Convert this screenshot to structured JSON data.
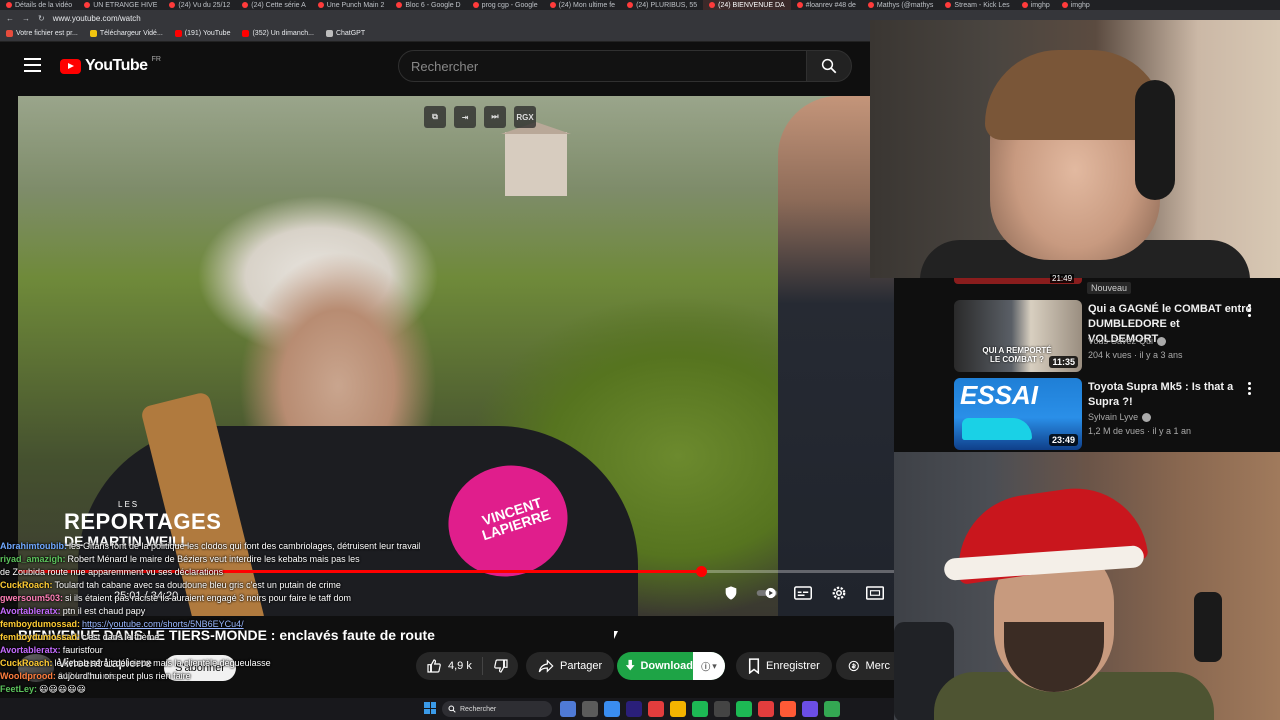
{
  "browser": {
    "tabs": [
      "Détails de la vidéo",
      "UN ETRANGE HIVE",
      "(24) Vu du 25/12",
      "(24) Cette série A",
      "Une Punch Main 2",
      "Bloc 6 - Google D",
      "prog cgp - Google",
      "(24) Mon ultime fe",
      "(24) PLURIBUS, 55",
      "(24) BIENVENUE DA",
      "#loanrev #48 de",
      "Mathys (@mathys",
      "Stream - Kick Les",
      "imghp",
      "imghp"
    ],
    "active_tab_index": 9,
    "url": "www.youtube.com/watch",
    "bookmarks": [
      {
        "label": "Votre fichier est pr...",
        "color": "#e74c3c"
      },
      {
        "label": "Téléchargeur Vidé...",
        "color": "#f1c40f"
      },
      {
        "label": "(191) YouTube",
        "color": "#ff0000"
      },
      {
        "label": "(352) Un dimanch...",
        "color": "#ff0000"
      },
      {
        "label": "ChatGPT",
        "color": "#bdbdbd"
      }
    ]
  },
  "header": {
    "logo_text": "YouTube",
    "logo_region": "FR",
    "search_placeholder": "Rechercher"
  },
  "player": {
    "top_controls": [
      "⧉",
      "⇥",
      "⏭",
      "RGX"
    ],
    "overlay": {
      "les": "LES",
      "reportages": "REPORTAGES",
      "sub": "DE MARTIN WEILL"
    },
    "time": "25:01 / 34:20",
    "progress": 0.78,
    "mic_text": "VINCENT LAPIERRE"
  },
  "video": {
    "title": "BIENVENUE DANS LE TIERS-MONDE : enclavés faute de route",
    "channel": "Vincent Lapierre",
    "subscribers": "642 k abonnés",
    "subscribe_label": "S'abonner",
    "likes": "4,9 k",
    "share_label": "Partager",
    "download_label": "Download",
    "save_label": "Enregistrer",
    "merci_label": "Merc"
  },
  "chat": [
    {
      "user": "Abrahimtoubib:",
      "color": "#6fa8ff",
      "msg": "les Gitans font de la politique les clodos qui font des cambriolages, détruisent leur travail"
    },
    {
      "user": "riyad_amazigh:",
      "color": "#5cc35c",
      "msg": "Robert Ménard le maire de Béziers veut interdire les kebabs mais pas les"
    },
    {
      "user": "",
      "color": "#fff",
      "msg": "de Zoubida route nue apparemment vu ses déclarations"
    },
    {
      "user": "CuckRoach:",
      "color": "#ffcc33",
      "msg": "Toulard tah cabane avec sa doudoune bleu gris c'est un putain de crime"
    },
    {
      "user": "gwersoum503:",
      "color": "#ff7eb6",
      "msg": "si ils étaient pas raciste ils auraient engagé 3 noirs pour faire le taff dom"
    },
    {
      "user": "Avortableratx:",
      "color": "#c46bff",
      "msg": "ptn il est chaud papy"
    },
    {
      "user": "femboydumossad:",
      "color": "#ffcc33",
      "msg": "https://youtube.com/shorts/5NB6EYCu4/",
      "link": true
    },
    {
      "user": "femboydumossad:",
      "color": "#ffcc33",
      "msg": "c'est dans le thème"
    },
    {
      "user": "Avortableratx:",
      "color": "#c46bff",
      "msg": "fauristfour"
    },
    {
      "user": "CuckRoach:",
      "color": "#ffcc33",
      "msg": "le kebab serait délicieux mais la clientèle dégueulasse"
    },
    {
      "user": "Wooldprood:",
      "color": "#ff7e3e",
      "msg": "aujourd'hui on peut plus rien faire"
    },
    {
      "user": "FeetLey:",
      "color": "#5cc35c",
      "msg": "😃😃😃😃😃"
    }
  ],
  "sidebar": {
    "nouveau": "Nouveau",
    "prev_duration": "21:49",
    "recs": [
      {
        "title": "Qui a GAGNÉ le COMBAT entre DUMBLEDORE et VOLDEMORT...",
        "channel": "Vous-Savez-Qui",
        "meta": "204 k vues · il y a 3 ans",
        "duration": "11:35",
        "thumb_text": "QUI A REMPORTÉ LE COMBAT ?"
      },
      {
        "title": "Toyota Supra Mk5 : Is that a Supra ?!",
        "channel": "Sylvain Lyve",
        "meta": "1,2 M de vues · il y a 1 an",
        "duration": "23:49",
        "thumb_text": "ESSAI"
      }
    ]
  },
  "taskbar": {
    "search_placeholder": "Rechercher",
    "apps": [
      "#4f7ad6",
      "#5b5b5b",
      "#3a8df0",
      "#2a1f7a",
      "#e23d3d",
      "#f4b400",
      "#1db954",
      "#444",
      "#1db954",
      "#e23d3d",
      "#ff5a36",
      "#6b4ee6",
      "#34a853"
    ]
  }
}
